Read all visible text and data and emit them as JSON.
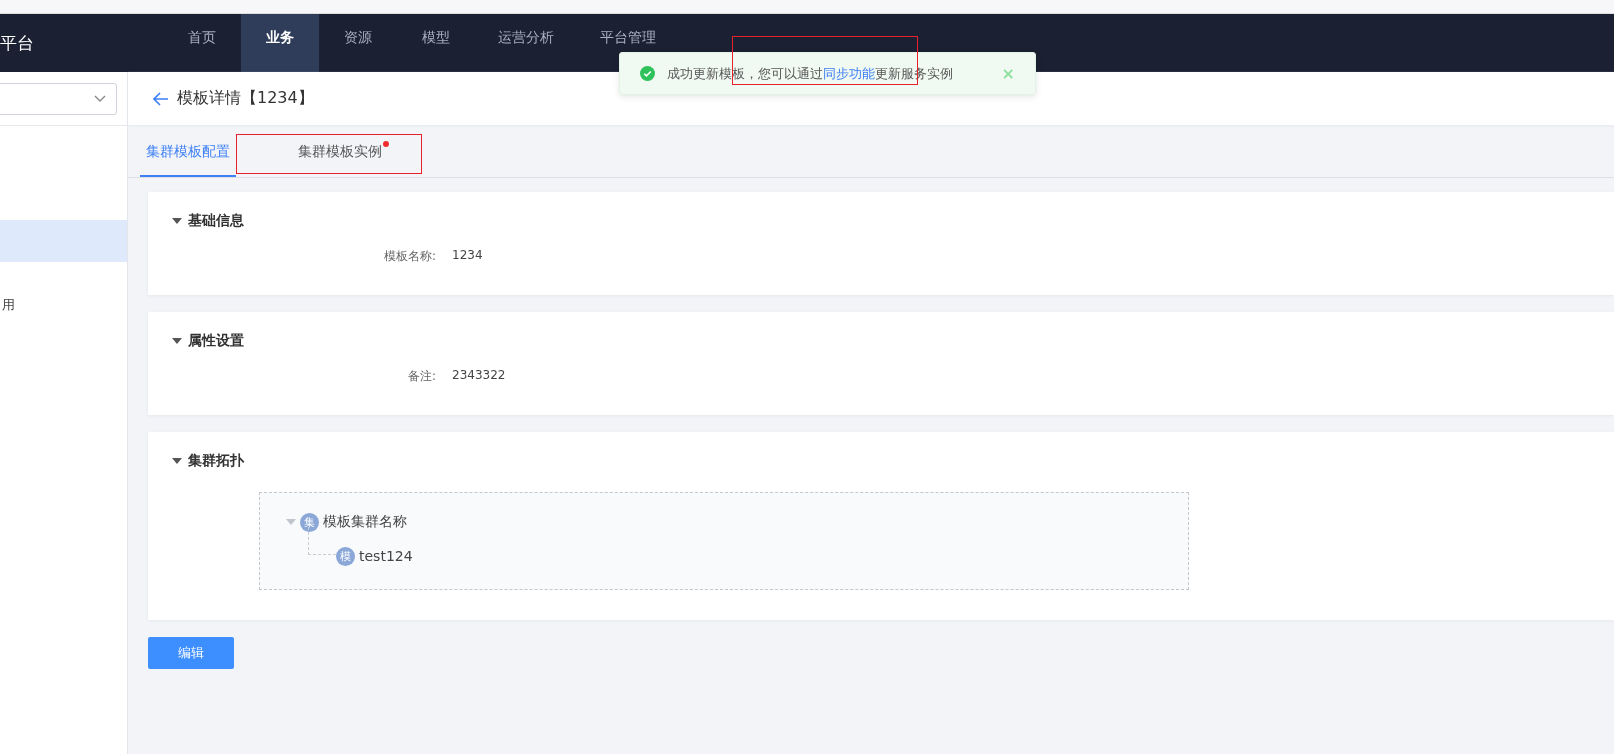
{
  "header": {
    "brand": "平台",
    "nav": [
      {
        "label": "首页",
        "selected": false
      },
      {
        "label": "业务",
        "selected": true
      },
      {
        "label": "资源",
        "selected": false
      },
      {
        "label": "模型",
        "selected": false
      },
      {
        "label": "运营分析",
        "selected": false
      },
      {
        "label": "平台管理",
        "selected": false
      }
    ]
  },
  "sidebar": {
    "items": [
      {
        "selected": true
      },
      {
        "label": "用",
        "selected": false
      }
    ]
  },
  "page": {
    "title": "模板详情【1234】"
  },
  "tabs": [
    {
      "label": "集群模板配置",
      "selected": true,
      "dot": false
    },
    {
      "label": "集群模板实例",
      "selected": false,
      "dot": true
    }
  ],
  "sections": [
    {
      "title": "基础信息",
      "expanded": true,
      "kind": "fields",
      "fields": [
        {
          "label": "模板名称:",
          "value": "1234"
        }
      ]
    },
    {
      "title": "属性设置",
      "expanded": true,
      "kind": "fields",
      "fields": [
        {
          "label": "备注:",
          "value": "2343322"
        }
      ]
    },
    {
      "title": "集群拓扑",
      "expanded": true,
      "kind": "tree",
      "tree": [
        {
          "badge": "集",
          "label": "模板集群名称",
          "expanded": true,
          "children": [
            {
              "badge": "模",
              "label": "test124"
            }
          ]
        }
      ]
    }
  ],
  "buttons": [
    "编辑"
  ],
  "toast": {
    "text_before": "成功更新模板，您可以通过",
    "link": "同步功能",
    "text_after": "更新服务实例",
    "close": "×"
  }
}
